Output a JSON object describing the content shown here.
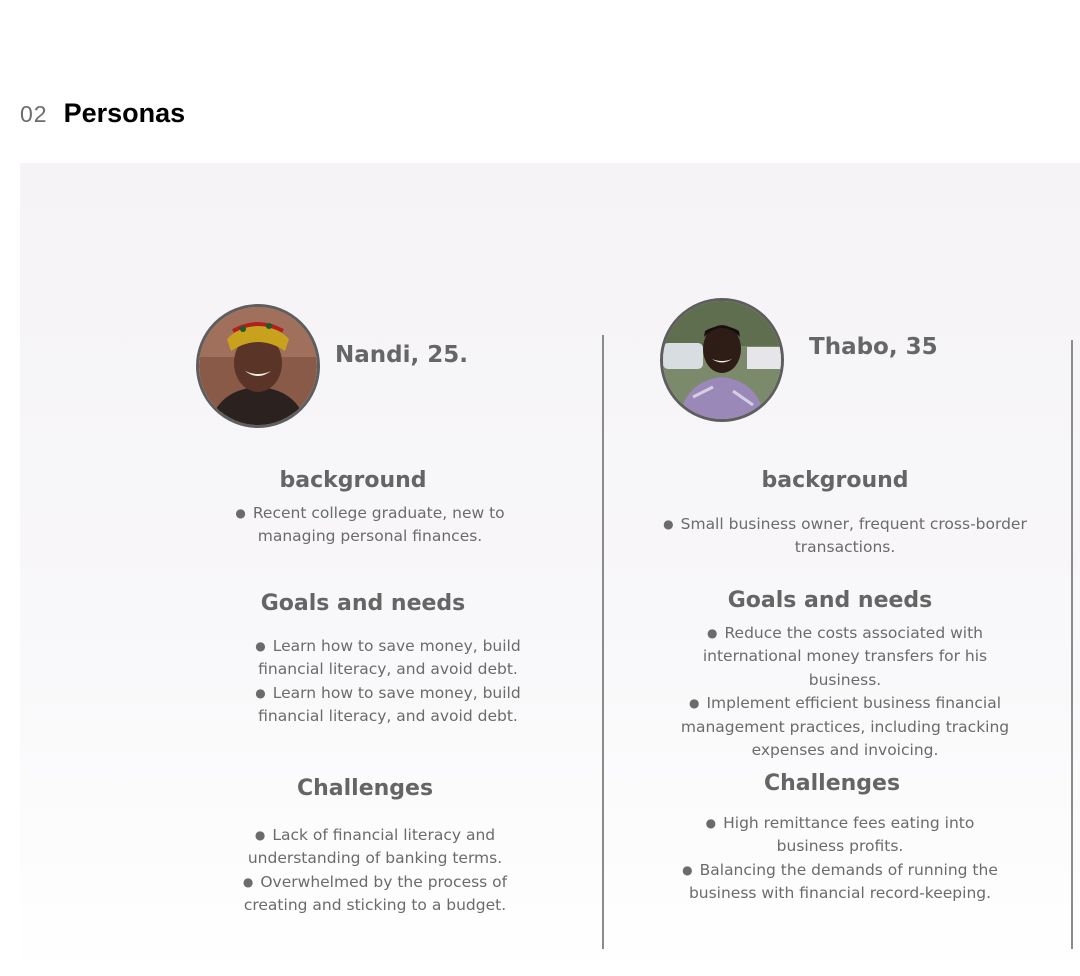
{
  "section": {
    "number": "02",
    "title": "Personas"
  },
  "personas": [
    {
      "name": "Nandi, 25.",
      "background_heading": "background",
      "background": [
        "Recent college graduate, new to",
        "managing personal finances."
      ],
      "goals_heading": "Goals and needs",
      "goals": [
        [
          "Learn how to save money, build",
          "financial literacy, and avoid debt."
        ],
        [
          "Learn how to save money, build",
          "financial literacy, and avoid debt."
        ]
      ],
      "challenges_heading": "Challenges",
      "challenges": [
        [
          "Lack of financial literacy and",
          "understanding of banking terms."
        ],
        [
          "Overwhelmed by the process of",
          "creating and sticking to a budget."
        ]
      ]
    },
    {
      "name": "Thabo, 35",
      "background_heading": "background",
      "background": [
        "Small business owner, frequent cross-border",
        "transactions."
      ],
      "goals_heading": "Goals and needs",
      "goals": [
        [
          "Reduce the costs associated with",
          "international money transfers for his",
          "business."
        ],
        [
          "Implement efficient business financial",
          "management practices, including tracking",
          "expenses and invoicing."
        ]
      ],
      "challenges_heading": "Challenges",
      "challenges": [
        [
          "High remittance fees eating into",
          "business profits."
        ],
        [
          "Balancing the demands of running the",
          "business with financial record-keeping."
        ]
      ]
    }
  ],
  "colors": {
    "panel_bg": "#f5f3f6",
    "text_heading": "#656565",
    "text_body": "#6b6b6b",
    "divider": "#8b8b8b"
  }
}
